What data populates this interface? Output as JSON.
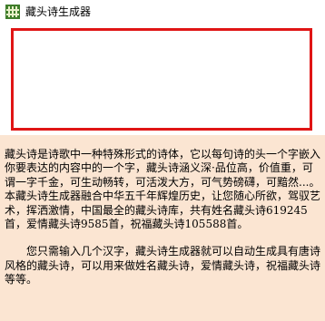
{
  "window": {
    "title": "藏头诗生成器",
    "app_icon_name": "app-icon"
  },
  "input": {
    "value": "",
    "border_color": "#e01515"
  },
  "description": {
    "paragraph1": "藏头诗是诗歌中一种特殊形式的诗体，它以每句诗的头一个字嵌入你要表达的内容中的一个字，藏头诗涵义深·品位高，价值重，可谓一字千金，可生动畅转，可活泼大方，可气势磅礴，可黯然...。本藏头诗生成器融合中华五千年辉煌历史，让您随心所欲，驾驭艺术，挥洒激情，中国最全的藏头诗库，共有姓名藏头诗619245首，爱情藏头诗9585首，祝福藏头诗105588首。",
    "paragraph2": "您只需输入几个汉字，藏头诗生成器就可以自动生成具有唐诗风格的藏头诗，可以用来做姓名藏头诗，爱情藏头诗，祝福藏头诗等等。",
    "background_color": "#fbe5d2"
  }
}
